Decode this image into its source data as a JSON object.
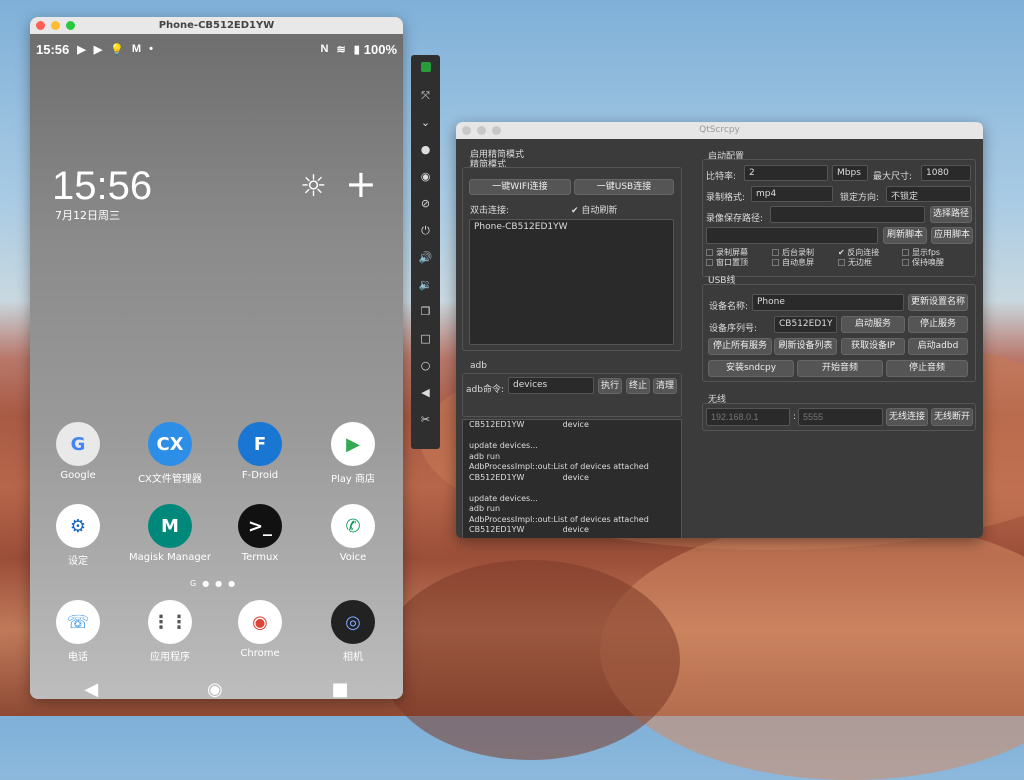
{
  "phone_window": {
    "title": "Phone-CB512ED1YW"
  },
  "status_bar": {
    "time": "15:56",
    "battery": "100%"
  },
  "lockscreen": {
    "clock": "15:56",
    "date": "7月12日周三"
  },
  "apps": [
    {
      "label": "Google",
      "glyph": "G",
      "bg": "#e9e9e9",
      "fg": "#4285f4"
    },
    {
      "label": "CX文件管理器",
      "glyph": "CX",
      "bg": "#2d8ee8",
      "fg": "#fff"
    },
    {
      "label": "F-Droid",
      "glyph": "F",
      "bg": "#1976d2",
      "fg": "#fff"
    },
    {
      "label": "Play 商店",
      "glyph": "▶",
      "bg": "#fff",
      "fg": "#34a853"
    },
    {
      "label": "设定",
      "glyph": "⚙",
      "bg": "#fff",
      "fg": "#1565c0"
    },
    {
      "label": "Magisk Manager",
      "glyph": "M",
      "bg": "#00897b",
      "fg": "#fff"
    },
    {
      "label": "Termux",
      "glyph": ">_",
      "bg": "#111",
      "fg": "#fff"
    },
    {
      "label": "Voice",
      "glyph": "✆",
      "bg": "#fff",
      "fg": "#0f9d58"
    },
    {
      "label": "电话",
      "glyph": "☏",
      "bg": "#fff",
      "fg": "#1e88e5"
    },
    {
      "label": "应用程序",
      "glyph": "⋮⋮",
      "bg": "#fff",
      "fg": "#555"
    },
    {
      "label": "Chrome",
      "glyph": "◉",
      "bg": "#fff",
      "fg": "#db4437"
    },
    {
      "label": "相机",
      "glyph": "◎",
      "bg": "#222",
      "fg": "#7fa7ff"
    }
  ],
  "qt": {
    "title": "QtScrcpy",
    "simple_mode_title": "启用精简模式",
    "simple_mode_check": "精简模式",
    "wifi_connect": "一键WIFI连接",
    "usb_connect": "一键USB连接",
    "double_click_connect": "双击连接:",
    "auto_refresh": "自动刷新",
    "device_list_item": "Phone-CB512ED1YW",
    "adb_title": "adb",
    "adb_cmd_label": "adb命令:",
    "adb_cmd_value": "devices",
    "execute": "执行",
    "stop": "终止",
    "clear": "清理",
    "log": "CB512ED1YW               device\n\nupdate devices...\nadb run\nAdbProcessImpl::out:List of devices attached\nCB512ED1YW               device\n\nupdate devices...\nadb run\nAdbProcessImpl::out:List of devices attached\nCB512ED1YW               device",
    "launch_config": "启动配置",
    "bitrate_label": "比特率:",
    "bitrate_value": "2",
    "bitrate_unit": "Mbps",
    "max_size_label": "最大尺寸:",
    "max_size_value": "1080",
    "record_format_label": "录制格式:",
    "record_format_value": "mp4",
    "lock_dir_label": "锁定方向:",
    "lock_dir_value": "不锁定",
    "save_path_label": "录像保存路径:",
    "select_path": "选择路径",
    "refresh_script": "刷新脚本",
    "apply_script": "应用脚本",
    "checks": [
      "录制屏幕",
      "后台录制",
      "反向连接",
      "显示fps",
      "窗口置顶",
      "自动息屏",
      "无边框",
      "保持唤醒"
    ],
    "usb_title": "USB线",
    "device_name_label": "设备名称:",
    "device_name_value": "Phone",
    "update_name": "更新设置名称",
    "serial_label": "设备序列号:",
    "serial_value": "CB512ED1Y",
    "start_server": "启动服务",
    "stop_server": "停止服务",
    "stop_all": "停止所有服务",
    "refresh_devices": "刷新设备列表",
    "get_ip": "获取设备IP",
    "start_adbd": "启动adbd",
    "install_sndcpy": "安装sndcpy",
    "start_audio": "开始音频",
    "stop_audio": "停止音频",
    "wireless_title": "无线",
    "ip_placeholder": "192.168.0.1",
    "port_placeholder": "5555",
    "wireless_connect": "无线连接",
    "wireless_disconnect": "无线断开"
  }
}
